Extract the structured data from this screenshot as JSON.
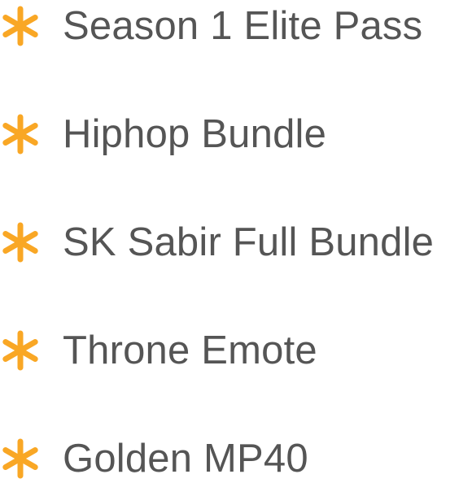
{
  "accent_color": "#F9A725",
  "text_color": "#555555",
  "bullet_icon": "asterisk-icon",
  "items": [
    {
      "label": "Season 1 Elite Pass"
    },
    {
      "label": "Hiphop Bundle"
    },
    {
      "label": "SK Sabir Full Bundle"
    },
    {
      "label": "Throne Emote"
    },
    {
      "label": "Golden MP40"
    }
  ]
}
